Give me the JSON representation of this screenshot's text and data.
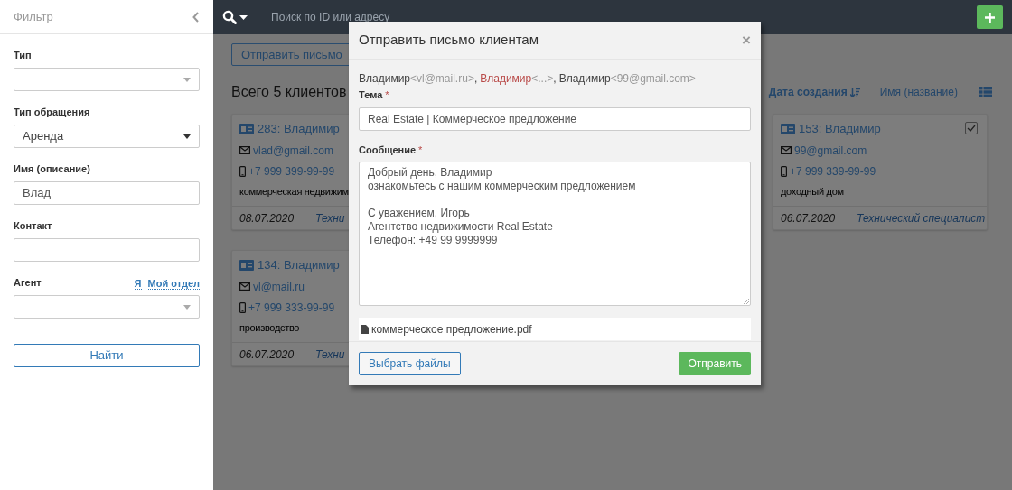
{
  "sidebar": {
    "title": "Фильтр",
    "fields": [
      {
        "kind": "select",
        "label": "Тип"
      },
      {
        "kind": "select",
        "label": "Тип обращения",
        "value": "Аренда"
      },
      {
        "kind": "input",
        "label": "Имя (описание)",
        "value": "Влад"
      },
      {
        "kind": "input",
        "label": "Контакт"
      },
      {
        "kind": "select",
        "label": "Агент",
        "links": [
          "Я",
          "Мой отдел"
        ]
      }
    ],
    "button": "Найти"
  },
  "topbar": {
    "search_placeholder": "Поиск по ID или адресу"
  },
  "toolbar": {
    "button": "Отправить письмо"
  },
  "heading": "Всего 5 клиентов",
  "sort": [
    {
      "label": "Дата создания",
      "selected": true
    },
    {
      "label": "Имя (название)",
      "selected": false
    }
  ],
  "card_columns": [
    {
      "cards": [
        {
          "title": "283: Владимир",
          "email": "vlad@gmail.com",
          "phone": "+7 999 399-99-99",
          "description": "коммерческая недвижим",
          "date": "08.07.2020",
          "role": "Техни"
        },
        {
          "title": "134: Владимир",
          "email": "vl@mail.ru",
          "phone": "+7 999 333-99-99",
          "description": "производство",
          "date": "06.07.2020",
          "role": "Техни"
        }
      ]
    },
    {
      "cards": [
        {
          "title": "153: Владимир",
          "email": "99@gmail.com",
          "phone": "+7 999 339-99-99",
          "description": "доходный дом",
          "date": "06.07.2020",
          "role": "Технический специалист",
          "checked": true
        }
      ]
    }
  ],
  "modal": {
    "title": "Отправить письмо клиентам",
    "close": "×",
    "recipients": [
      {
        "name": "Владимир",
        "address": "<vl@mail.ru>",
        "valid": true,
        "separator": ","
      },
      {
        "name": "Владимир",
        "address": "<...>",
        "valid": false,
        "separator": ","
      },
      {
        "name": "Владимир",
        "address": "<99@gmail.com>",
        "valid": true
      }
    ],
    "subject_label": {
      "text": "Тема",
      "mark": "*"
    },
    "subject": "Real Estate | Коммерческое предложение",
    "message_label": {
      "text": "Сообщение",
      "mark": "*"
    },
    "message": "Добрый день, Владимир\nознакомьтесь с нашим коммерческим предложением\n\nС уважением, Игорь\nАгентство недвижимости Real Estate\nТелефон: +49 99 9999999",
    "attachments": [
      "коммерческое предложение.pdf"
    ],
    "choose_button": "Выбрать файлы",
    "send_button": "Отправить"
  }
}
